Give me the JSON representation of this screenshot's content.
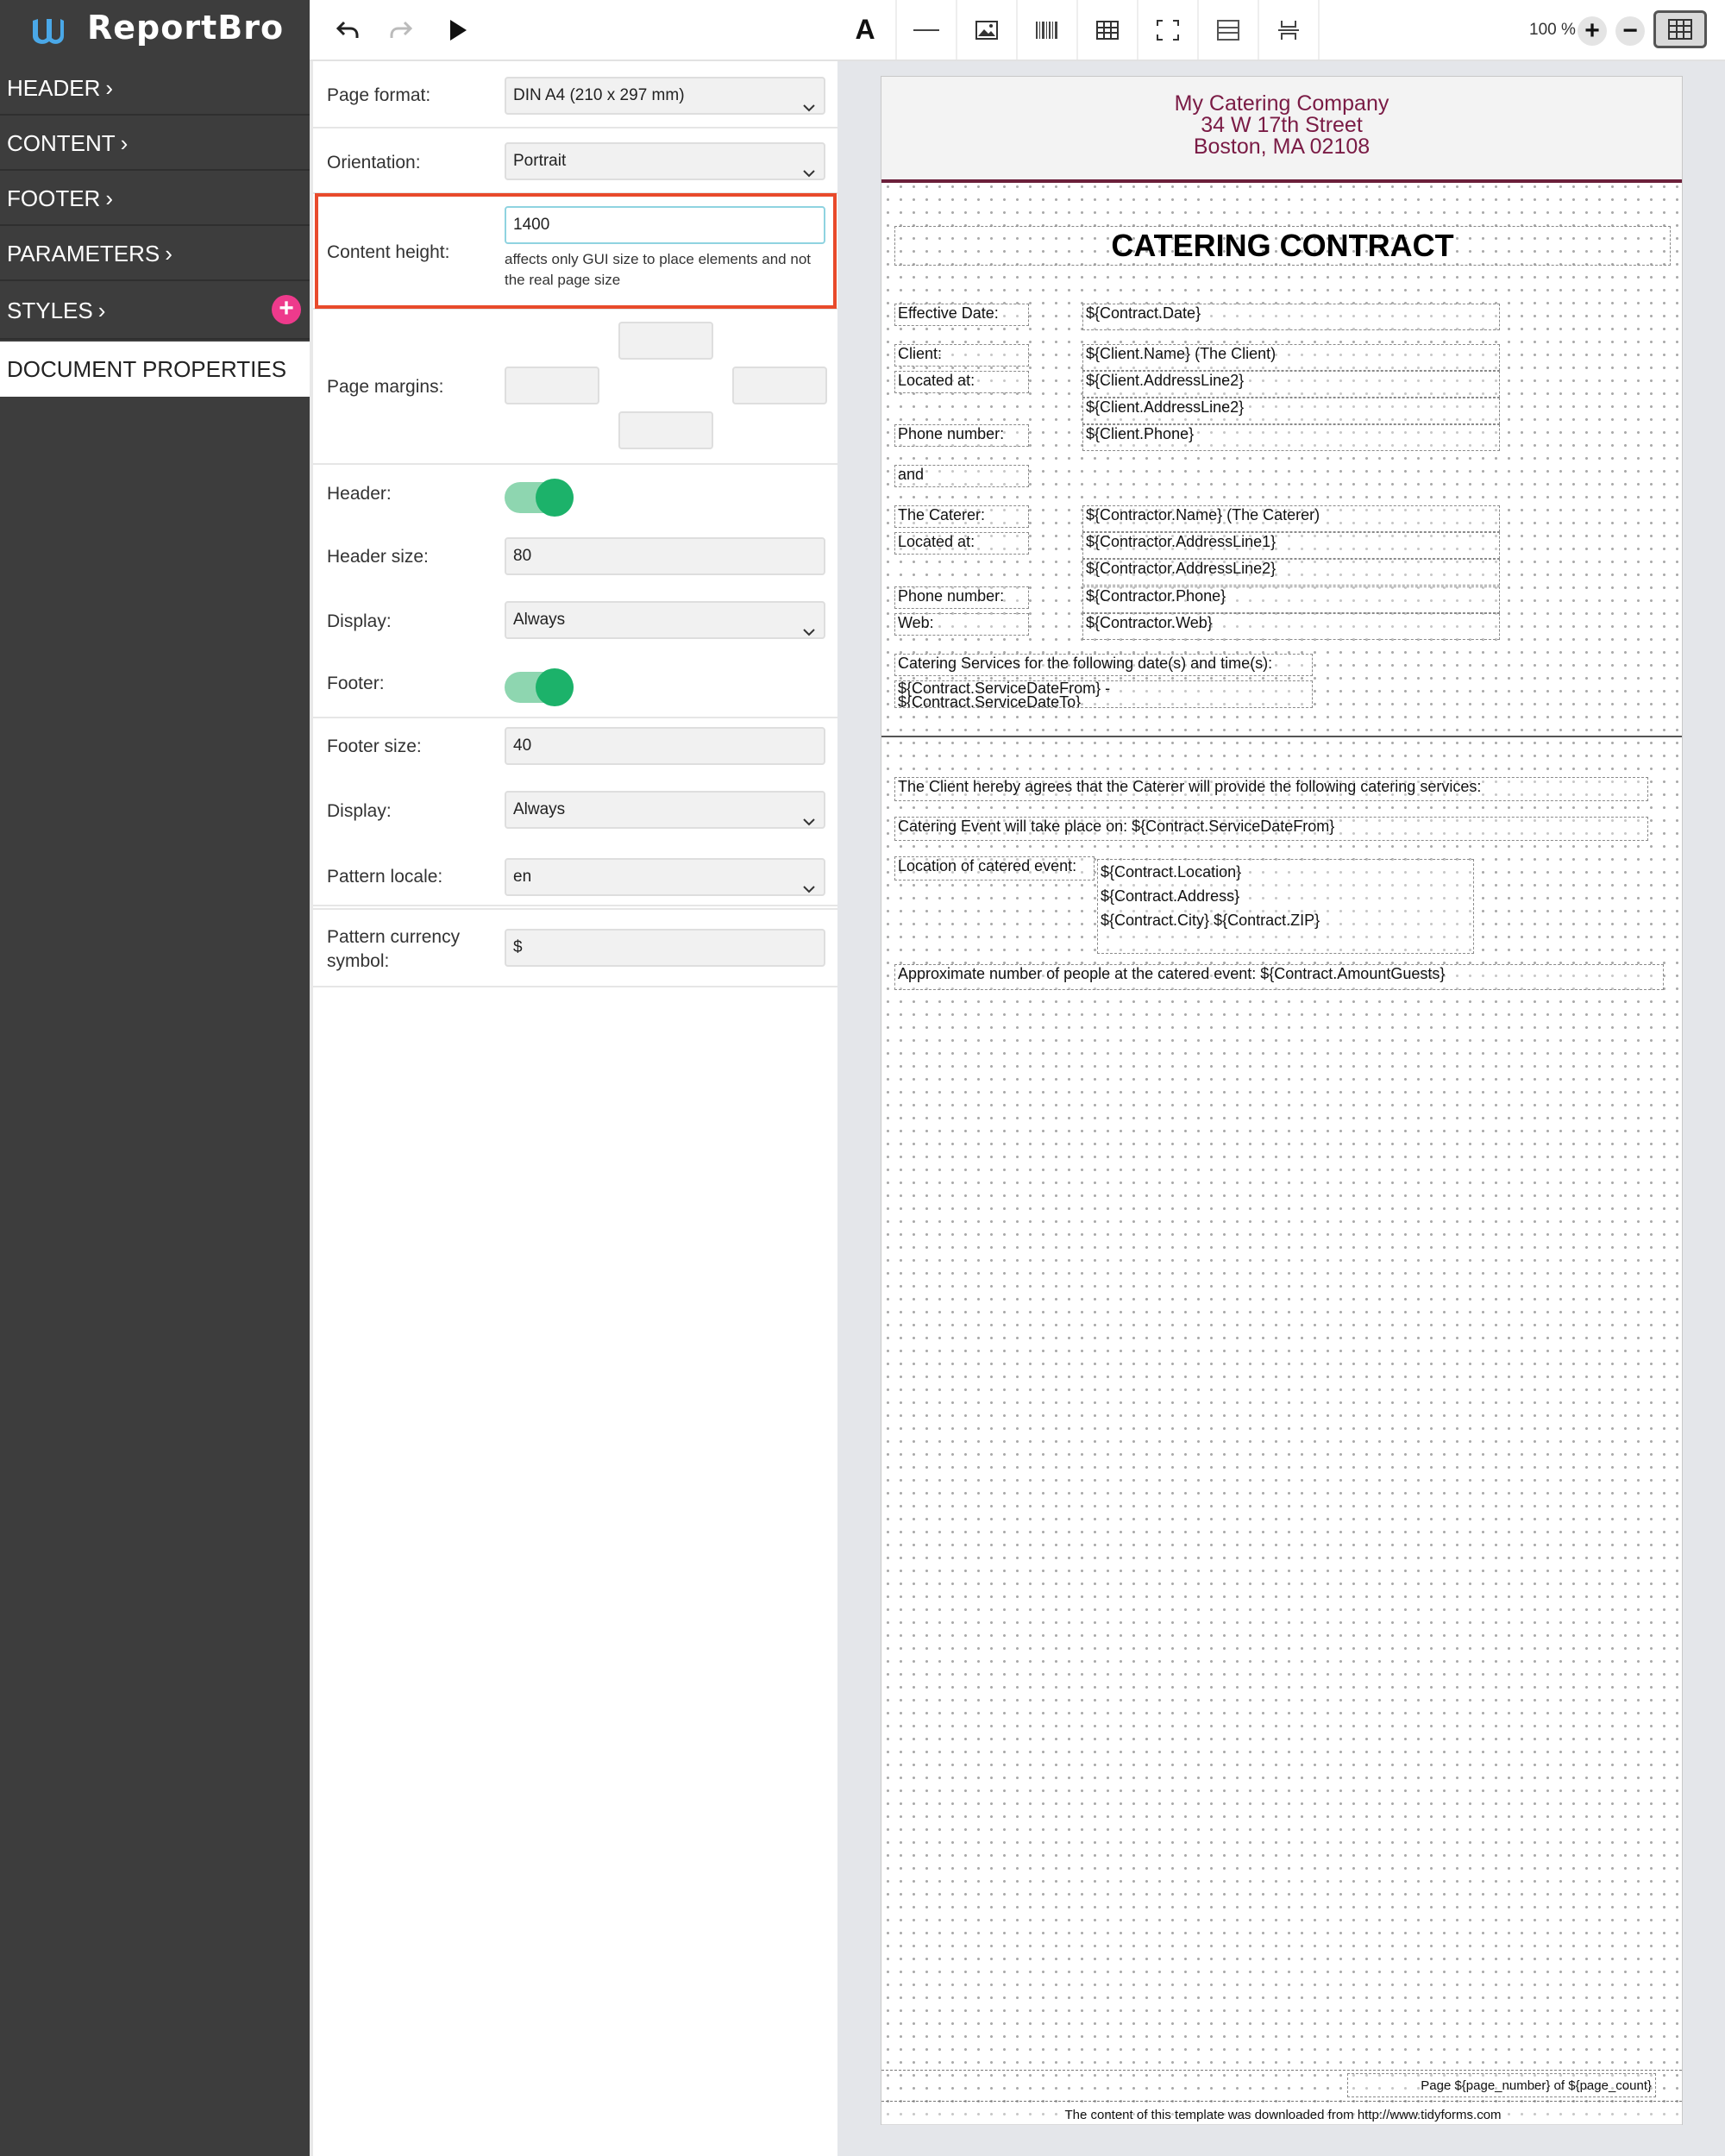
{
  "app": {
    "name": "ReportBro"
  },
  "sidebar": {
    "items": [
      {
        "label": "HEADER",
        "chevron": "›"
      },
      {
        "label": "CONTENT",
        "chevron": "›"
      },
      {
        "label": "FOOTER",
        "chevron": "›"
      },
      {
        "label": "PARAMETERS",
        "chevron": "›"
      },
      {
        "label": "STYLES",
        "chevron": "›"
      },
      {
        "label": "DOCUMENT PROPERTIES"
      }
    ],
    "add_style_icon": "plus-icon"
  },
  "toolbar": {
    "icons": [
      "undo-icon",
      "redo-icon",
      "play-icon",
      "text-icon",
      "line-icon",
      "image-icon",
      "barcode-icon",
      "table-icon",
      "frame-icon",
      "section-icon",
      "page-break-icon"
    ],
    "zoom": "100 %",
    "zoom_in": "+",
    "zoom_out": "−",
    "text_tool": "A"
  },
  "properties": {
    "page_format": {
      "label": "Page format:",
      "value": "DIN A4 (210 x 297 mm)"
    },
    "orientation": {
      "label": "Orientation:",
      "value": "Portrait"
    },
    "content_height": {
      "label": "Content height:",
      "value": "1400",
      "help": "affects only GUI size to place elements and not the real page size"
    },
    "page_margins": {
      "label": "Page margins:"
    },
    "header": {
      "label": "Header:",
      "enabled": true
    },
    "header_size": {
      "label": "Header size:",
      "value": "80"
    },
    "header_display": {
      "label": "Display:",
      "value": "Always"
    },
    "footer": {
      "label": "Footer:",
      "enabled": true
    },
    "footer_size": {
      "label": "Footer size:",
      "value": "40"
    },
    "footer_display": {
      "label": "Display:",
      "value": "Always"
    },
    "pattern_locale": {
      "label": "Pattern locale:",
      "value": "en"
    },
    "pattern_currency": {
      "label": "Pattern currency symbol:",
      "value": "$"
    }
  },
  "document": {
    "company": [
      "My Catering Company",
      "34 W 17th Street",
      "Boston, MA 02108"
    ],
    "title": "CATERING CONTRACT",
    "labels": {
      "effective_date": "Effective Date:",
      "client": "Client:",
      "client_located": "Located at:",
      "client_phone": "Phone number:",
      "and": "and",
      "caterer": "The Caterer:",
      "caterer_located": "Located at:",
      "caterer_phone": "Phone number:",
      "web": "Web:",
      "services": "Catering Services for the following date(s) and time(s):"
    },
    "values": {
      "contract_date": "${Contract.Date}",
      "client_name": "${Client.Name} (The Client)",
      "client_addr1": "${Client.AddressLine2}",
      "client_addr2": "${Client.AddressLine2}",
      "client_phone": "${Client.Phone}",
      "contractor_name": "${Contractor.Name} (The Caterer)",
      "contractor_addr1": "${Contractor.AddressLine1}",
      "contractor_addr2": "${Contractor.AddressLine2}",
      "contractor_phone": "${Contractor.Phone}",
      "contractor_web": "${Contractor.Web}",
      "service_dates_1": "${Contract.ServiceDateFrom} -",
      "service_dates_2": "${Contract.ServiceDateTo}"
    },
    "content": {
      "agrees": "The Client hereby agrees that the Caterer will provide the following catering services:",
      "event_on": "Catering Event will take place on: ${Contract.ServiceDateFrom}",
      "location_label": "Location of catered event:",
      "location_1": "${Contract.Location}",
      "location_2": "${Contract.Address}",
      "location_3": "${Contract.City} ${Contract.ZIP}",
      "guests": "Approximate number of people at the catered event: ${Contract.AmountGuests}"
    },
    "footer": {
      "page_number": "Page ${page_number} of ${page_count}",
      "source": "The content of this template was downloaded from http://www.tidyforms.com"
    }
  },
  "colors": {
    "sidebar_bg": "#3d3d3d",
    "accent_pink": "#ee3a8c",
    "toggle_on": "#1cb26a",
    "highlight": "#e84a2b",
    "company_text": "#7a1b45",
    "header_line": "#6b1f3a"
  }
}
